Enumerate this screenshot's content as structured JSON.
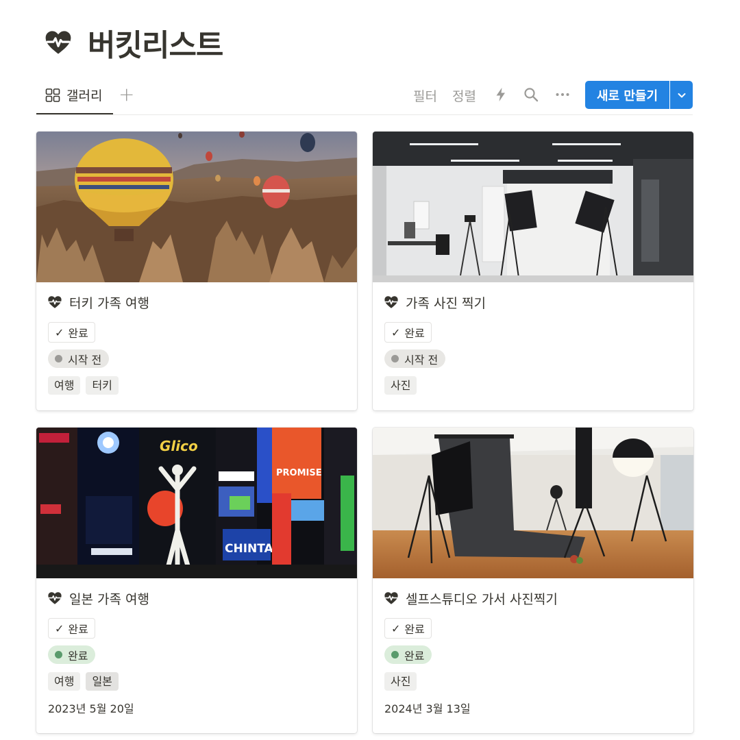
{
  "page": {
    "title": "버킷리스트",
    "icon": "heart-pulse-icon"
  },
  "toolbar": {
    "view_tab_label": "갤러리",
    "add_view": "+",
    "filter": "필터",
    "sort": "정렬",
    "new_button": "새로 만들기"
  },
  "cards": [
    {
      "title": "터키 가족 여행",
      "check": "완료",
      "status": "시작 전",
      "status_type": "gray",
      "tags": [
        "여행",
        "터키"
      ],
      "date": "",
      "cover": "hot-air-balloons-cappadocia"
    },
    {
      "title": "가족 사진 찍기",
      "check": "완료",
      "status": "시작 전",
      "status_type": "gray",
      "tags": [
        "사진"
      ],
      "date": "",
      "cover": "photo-studio-white"
    },
    {
      "title": "일본 가족 여행",
      "check": "완료",
      "status": "완료",
      "status_type": "green",
      "tags": [
        "여행",
        "일본"
      ],
      "date": "2023년 5월 20일",
      "cover": "dotonbori-neon-signs"
    },
    {
      "title": "셀프스튜디오 가서 사진찍기",
      "check": "완료",
      "status": "완료",
      "status_type": "green",
      "tags": [
        "사진"
      ],
      "date": "2024년 3월 13일",
      "cover": "photo-studio-backdrop"
    }
  ],
  "cover_signs": {
    "glico": "Glico",
    "promise": "PROMISE",
    "chintai": "CHINTAI"
  },
  "colors": {
    "accent": "#2383e2",
    "text": "#37352f",
    "muted": "#9b9a97",
    "status_green": "#dbeddb",
    "status_gray": "#e8e7e4"
  }
}
